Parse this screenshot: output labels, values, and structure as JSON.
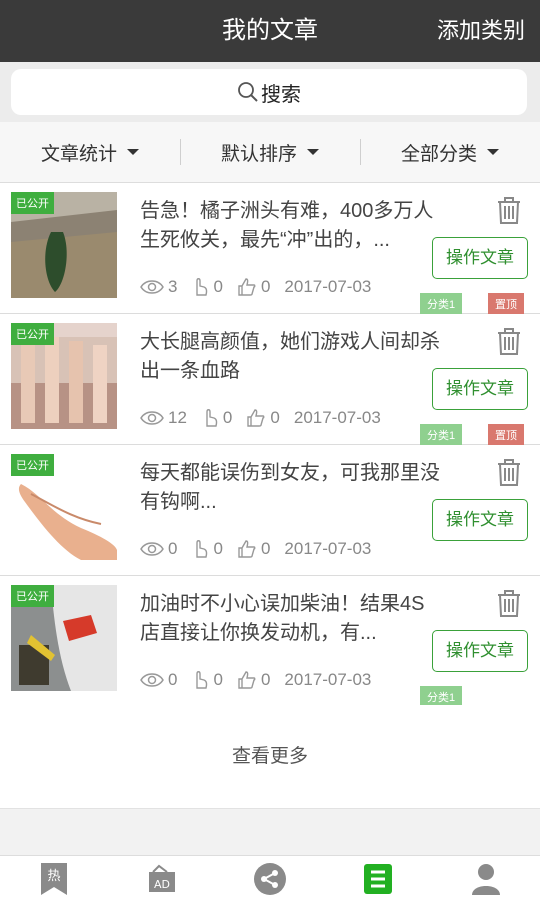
{
  "header": {
    "title": "我的文章",
    "action": "添加类别"
  },
  "search": {
    "label": "搜索"
  },
  "filters": [
    {
      "label": "文章统计"
    },
    {
      "label": "默认排序"
    },
    {
      "label": "全部分类"
    }
  ],
  "articles": [
    {
      "status": "已公开",
      "title": "告急！橘子洲头有难，400多万人生死攸关，最先“冲”出的，...",
      "views": "3",
      "clicks": "0",
      "likes": "0",
      "date": "2017-07-03",
      "action": "操作文章",
      "category": "分类1",
      "pinned": "置顶"
    },
    {
      "status": "已公开",
      "title": "大长腿高颜值，她们游戏人间却杀出一条血路",
      "views": "12",
      "clicks": "0",
      "likes": "0",
      "date": "2017-07-03",
      "action": "操作文章",
      "category": "分类1",
      "pinned": "置顶"
    },
    {
      "status": "已公开",
      "title": "每天都能误伤到女友，可我那里没有钩啊...",
      "views": "0",
      "clicks": "0",
      "likes": "0",
      "date": "2017-07-03",
      "action": "操作文章"
    },
    {
      "status": "已公开",
      "title": "加油时不小心误加柴油！结果4S店直接让你换发动机，有...",
      "views": "0",
      "clicks": "0",
      "likes": "0",
      "date": "2017-07-03",
      "action": "操作文章",
      "category": "分类1"
    }
  ],
  "more": "查看更多",
  "tabs": [
    {
      "icon": "hot-bookmark-icon"
    },
    {
      "icon": "ad-icon"
    },
    {
      "icon": "share-icon"
    },
    {
      "icon": "article-list-icon",
      "active": true
    },
    {
      "icon": "user-icon"
    }
  ],
  "colors": {
    "header": "#3a3a3a",
    "accent": "#3aa13a",
    "pinned": "#d9786e",
    "category": "#8fd08f"
  }
}
